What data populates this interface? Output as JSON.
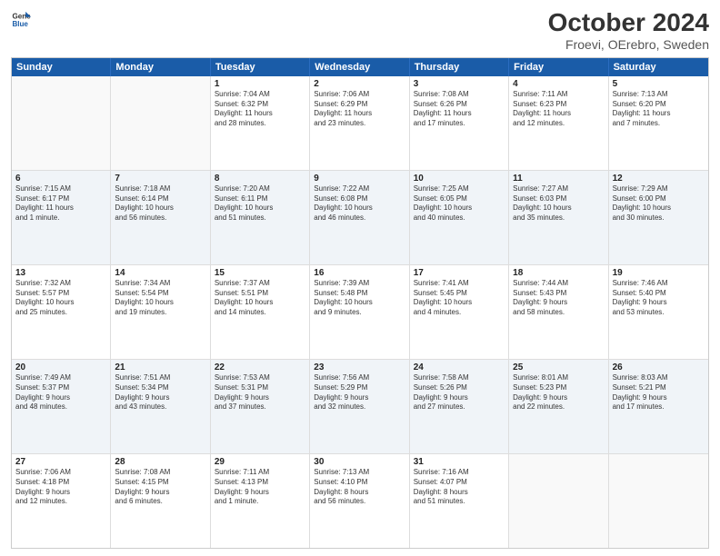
{
  "header": {
    "logo_line1": "General",
    "logo_line2": "Blue",
    "title": "October 2024",
    "subtitle": "Froevi, OErebro, Sweden"
  },
  "days_of_week": [
    "Sunday",
    "Monday",
    "Tuesday",
    "Wednesday",
    "Thursday",
    "Friday",
    "Saturday"
  ],
  "weeks": [
    [
      {
        "day": "",
        "lines": []
      },
      {
        "day": "",
        "lines": []
      },
      {
        "day": "1",
        "lines": [
          "Sunrise: 7:04 AM",
          "Sunset: 6:32 PM",
          "Daylight: 11 hours",
          "and 28 minutes."
        ]
      },
      {
        "day": "2",
        "lines": [
          "Sunrise: 7:06 AM",
          "Sunset: 6:29 PM",
          "Daylight: 11 hours",
          "and 23 minutes."
        ]
      },
      {
        "day": "3",
        "lines": [
          "Sunrise: 7:08 AM",
          "Sunset: 6:26 PM",
          "Daylight: 11 hours",
          "and 17 minutes."
        ]
      },
      {
        "day": "4",
        "lines": [
          "Sunrise: 7:11 AM",
          "Sunset: 6:23 PM",
          "Daylight: 11 hours",
          "and 12 minutes."
        ]
      },
      {
        "day": "5",
        "lines": [
          "Sunrise: 7:13 AM",
          "Sunset: 6:20 PM",
          "Daylight: 11 hours",
          "and 7 minutes."
        ]
      }
    ],
    [
      {
        "day": "6",
        "lines": [
          "Sunrise: 7:15 AM",
          "Sunset: 6:17 PM",
          "Daylight: 11 hours",
          "and 1 minute."
        ]
      },
      {
        "day": "7",
        "lines": [
          "Sunrise: 7:18 AM",
          "Sunset: 6:14 PM",
          "Daylight: 10 hours",
          "and 56 minutes."
        ]
      },
      {
        "day": "8",
        "lines": [
          "Sunrise: 7:20 AM",
          "Sunset: 6:11 PM",
          "Daylight: 10 hours",
          "and 51 minutes."
        ]
      },
      {
        "day": "9",
        "lines": [
          "Sunrise: 7:22 AM",
          "Sunset: 6:08 PM",
          "Daylight: 10 hours",
          "and 46 minutes."
        ]
      },
      {
        "day": "10",
        "lines": [
          "Sunrise: 7:25 AM",
          "Sunset: 6:05 PM",
          "Daylight: 10 hours",
          "and 40 minutes."
        ]
      },
      {
        "day": "11",
        "lines": [
          "Sunrise: 7:27 AM",
          "Sunset: 6:03 PM",
          "Daylight: 10 hours",
          "and 35 minutes."
        ]
      },
      {
        "day": "12",
        "lines": [
          "Sunrise: 7:29 AM",
          "Sunset: 6:00 PM",
          "Daylight: 10 hours",
          "and 30 minutes."
        ]
      }
    ],
    [
      {
        "day": "13",
        "lines": [
          "Sunrise: 7:32 AM",
          "Sunset: 5:57 PM",
          "Daylight: 10 hours",
          "and 25 minutes."
        ]
      },
      {
        "day": "14",
        "lines": [
          "Sunrise: 7:34 AM",
          "Sunset: 5:54 PM",
          "Daylight: 10 hours",
          "and 19 minutes."
        ]
      },
      {
        "day": "15",
        "lines": [
          "Sunrise: 7:37 AM",
          "Sunset: 5:51 PM",
          "Daylight: 10 hours",
          "and 14 minutes."
        ]
      },
      {
        "day": "16",
        "lines": [
          "Sunrise: 7:39 AM",
          "Sunset: 5:48 PM",
          "Daylight: 10 hours",
          "and 9 minutes."
        ]
      },
      {
        "day": "17",
        "lines": [
          "Sunrise: 7:41 AM",
          "Sunset: 5:45 PM",
          "Daylight: 10 hours",
          "and 4 minutes."
        ]
      },
      {
        "day": "18",
        "lines": [
          "Sunrise: 7:44 AM",
          "Sunset: 5:43 PM",
          "Daylight: 9 hours",
          "and 58 minutes."
        ]
      },
      {
        "day": "19",
        "lines": [
          "Sunrise: 7:46 AM",
          "Sunset: 5:40 PM",
          "Daylight: 9 hours",
          "and 53 minutes."
        ]
      }
    ],
    [
      {
        "day": "20",
        "lines": [
          "Sunrise: 7:49 AM",
          "Sunset: 5:37 PM",
          "Daylight: 9 hours",
          "and 48 minutes."
        ]
      },
      {
        "day": "21",
        "lines": [
          "Sunrise: 7:51 AM",
          "Sunset: 5:34 PM",
          "Daylight: 9 hours",
          "and 43 minutes."
        ]
      },
      {
        "day": "22",
        "lines": [
          "Sunrise: 7:53 AM",
          "Sunset: 5:31 PM",
          "Daylight: 9 hours",
          "and 37 minutes."
        ]
      },
      {
        "day": "23",
        "lines": [
          "Sunrise: 7:56 AM",
          "Sunset: 5:29 PM",
          "Daylight: 9 hours",
          "and 32 minutes."
        ]
      },
      {
        "day": "24",
        "lines": [
          "Sunrise: 7:58 AM",
          "Sunset: 5:26 PM",
          "Daylight: 9 hours",
          "and 27 minutes."
        ]
      },
      {
        "day": "25",
        "lines": [
          "Sunrise: 8:01 AM",
          "Sunset: 5:23 PM",
          "Daylight: 9 hours",
          "and 22 minutes."
        ]
      },
      {
        "day": "26",
        "lines": [
          "Sunrise: 8:03 AM",
          "Sunset: 5:21 PM",
          "Daylight: 9 hours",
          "and 17 minutes."
        ]
      }
    ],
    [
      {
        "day": "27",
        "lines": [
          "Sunrise: 7:06 AM",
          "Sunset: 4:18 PM",
          "Daylight: 9 hours",
          "and 12 minutes."
        ]
      },
      {
        "day": "28",
        "lines": [
          "Sunrise: 7:08 AM",
          "Sunset: 4:15 PM",
          "Daylight: 9 hours",
          "and 6 minutes."
        ]
      },
      {
        "day": "29",
        "lines": [
          "Sunrise: 7:11 AM",
          "Sunset: 4:13 PM",
          "Daylight: 9 hours",
          "and 1 minute."
        ]
      },
      {
        "day": "30",
        "lines": [
          "Sunrise: 7:13 AM",
          "Sunset: 4:10 PM",
          "Daylight: 8 hours",
          "and 56 minutes."
        ]
      },
      {
        "day": "31",
        "lines": [
          "Sunrise: 7:16 AM",
          "Sunset: 4:07 PM",
          "Daylight: 8 hours",
          "and 51 minutes."
        ]
      },
      {
        "day": "",
        "lines": []
      },
      {
        "day": "",
        "lines": []
      }
    ]
  ]
}
